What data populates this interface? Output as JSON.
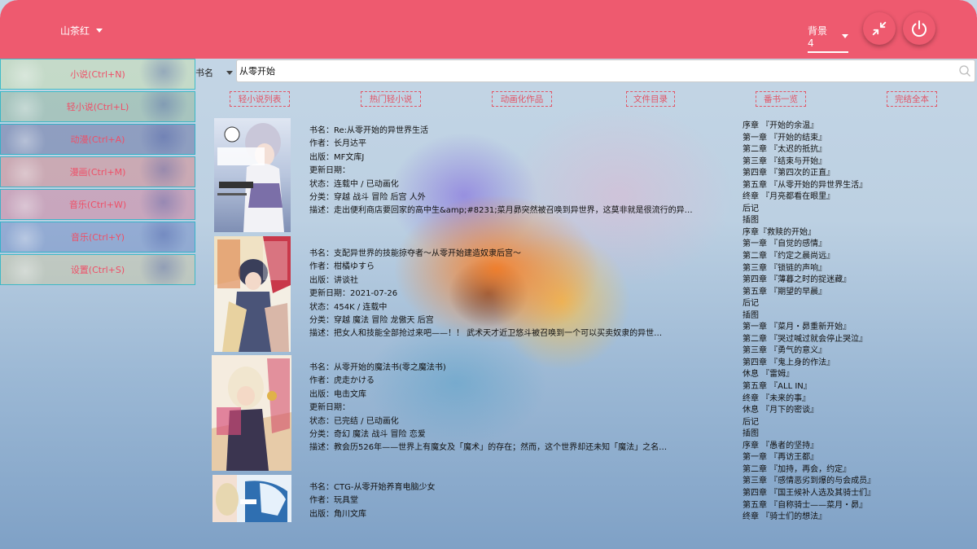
{
  "header": {
    "theme_label": "山茶红",
    "background_label": "背景4",
    "colors": {
      "topbar": "#ee5a6f",
      "accent": "#e25566"
    },
    "buttons": {
      "collapse_icon": "collapse-arrows-icon",
      "power_icon": "power-icon"
    }
  },
  "sidebar": {
    "items": [
      {
        "label": "小说(Ctrl+N)"
      },
      {
        "label": "轻小说(Ctrl+L)"
      },
      {
        "label": "动漫(Ctrl+A)"
      },
      {
        "label": "漫画(Ctrl+M)"
      },
      {
        "label": "音乐(Ctrl+W)"
      },
      {
        "label": "音乐(Ctrl+Y)"
      },
      {
        "label": "设置(Ctrl+S)"
      }
    ]
  },
  "search": {
    "field_label": "书名",
    "value": "从零开始",
    "icon": "search-icon"
  },
  "tags": [
    "轻小说列表",
    "热门轻小说",
    "动画化作品",
    "文件目录",
    "番书一览",
    "完结全本"
  ],
  "results": [
    {
      "title": "书名：Re:从零开始的异世界生活",
      "author": "作者：长月达平",
      "publisher": "出版：MF文库J",
      "updated": "更新日期：",
      "status": "状态：连载中 / 已动画化",
      "genres": "分类：穿越 战斗 冒险 后宫 人外",
      "desc": "描述：走出便利商店要回家的高中生&amp;#8231;菜月昴突然被召唤到异世界，这莫非就是很流行的异…"
    },
    {
      "title": "书名：支配异世界的技能掠夺者～从零开始建造奴隶后宫～",
      "author": "作者：柑橘ゆすら",
      "publisher": "出版：讲谈社",
      "updated": "更新日期：2021-07-26",
      "status": "状态：454K / 连载中",
      "genres": "分类：穿越 魔法 冒险 龙傲天 后宫",
      "desc": "描述：把女人和技能全部抢过来吧——！！ 武术天才近卫悠斗被召唤到一个可以买卖奴隶的异世…"
    },
    {
      "title": "书名：从零开始的魔法书(零之魔法书)",
      "author": "作者：虎走かける",
      "publisher": "出版：电击文库",
      "updated": "更新日期：",
      "status": "状态：已完结 / 已动画化",
      "genres": "分类：奇幻 魔法 战斗 冒险 恋爱",
      "desc": "描述：教会历526年——世界上有魔女及「魔术」的存在；然而，这个世界却还未知「魔法」之名…"
    },
    {
      "title": "书名：CTG-从零开始养育电脑少女",
      "author": "作者：玩具堂",
      "publisher": "出版：角川文库",
      "updated": "",
      "status": "",
      "genres": "",
      "desc": ""
    }
  ],
  "chapters": [
    "序章 『开始的余温』",
    "第一章 『开始的结束』",
    "第二章 『太迟的抵抗』",
    "第三章 『结束与开始』",
    "第四章 『第四次的正直』",
    "第五章 『从零开始的异世界生活』",
    "终章 『月亮都看在眼里』",
    "后记",
    "插图",
    "序章『救赎的开始』",
    "第一章 『自觉的感情』",
    "第二章 『约定之晨尚远』",
    "第三章 『锁链的声响』",
    "第四章 『薄暮之时的捉迷藏』",
    "第五章 『期望的早晨』",
    "后记",
    "插图",
    "第一章 『菜月・昴重新开始』",
    "第二章 『哭过喊过就会停止哭泣』",
    "第三章 『勇气的意义』",
    "第四章 『鬼上身的作法』",
    "休息 『雷姆』",
    "第五章 『ALL IN』",
    "终章 『未来的事』",
    "休息 『月下的密谈』",
    "后记",
    "插图",
    "序章 『愚者的坚持』",
    "第一章 『再访王都』",
    "第二章 『加持，再会，约定』",
    "第三章 『感情恶劣到爆的与会成员』",
    "第四章 『国王候补人选及其骑士们』",
    "第五章 『自称骑士——菜月・昴』",
    "终章 『骑士们的想法』"
  ]
}
